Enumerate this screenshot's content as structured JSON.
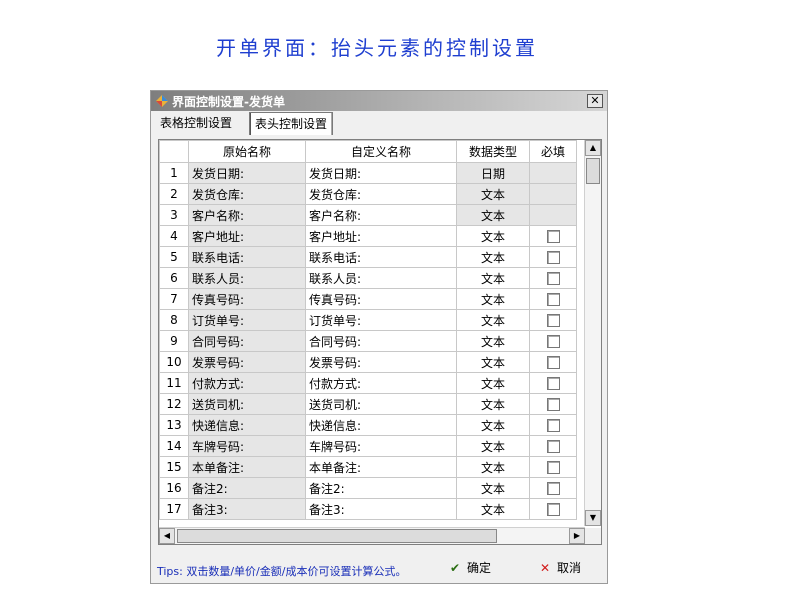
{
  "page_heading": "开单界面：抬头元素的控制设置",
  "window": {
    "title": "界面控制设置-发货单",
    "close_glyph": "✕"
  },
  "tabs": [
    {
      "label": "表格控制设置",
      "active": false
    },
    {
      "label": "表头控制设置",
      "active": true
    }
  ],
  "grid": {
    "headers": [
      "",
      "原始名称",
      "自定义名称",
      "数据类型",
      "必填"
    ],
    "rows": [
      {
        "no": "1",
        "original": "发货日期:",
        "custom": "发货日期:",
        "type": "日期",
        "locked": true
      },
      {
        "no": "2",
        "original": "发货仓库:",
        "custom": "发货仓库:",
        "type": "文本",
        "locked": true
      },
      {
        "no": "3",
        "original": "客户名称:",
        "custom": "客户名称:",
        "type": "文本",
        "locked": true
      },
      {
        "no": "4",
        "original": "客户地址:",
        "custom": "客户地址:",
        "type": "文本",
        "locked": false
      },
      {
        "no": "5",
        "original": "联系电话:",
        "custom": "联系电话:",
        "type": "文本",
        "locked": false
      },
      {
        "no": "6",
        "original": "联系人员:",
        "custom": "联系人员:",
        "type": "文本",
        "locked": false
      },
      {
        "no": "7",
        "original": "传真号码:",
        "custom": "传真号码:",
        "type": "文本",
        "locked": false
      },
      {
        "no": "8",
        "original": "订货单号:",
        "custom": "订货单号:",
        "type": "文本",
        "locked": false
      },
      {
        "no": "9",
        "original": "合同号码:",
        "custom": "合同号码:",
        "type": "文本",
        "locked": false
      },
      {
        "no": "10",
        "original": "发票号码:",
        "custom": "发票号码:",
        "type": "文本",
        "locked": false
      },
      {
        "no": "11",
        "original": "付款方式:",
        "custom": "付款方式:",
        "type": "文本",
        "locked": false
      },
      {
        "no": "12",
        "original": "送货司机:",
        "custom": "送货司机:",
        "type": "文本",
        "locked": false
      },
      {
        "no": "13",
        "original": "快递信息:",
        "custom": "快递信息:",
        "type": "文本",
        "locked": false
      },
      {
        "no": "14",
        "original": "车牌号码:",
        "custom": "车牌号码:",
        "type": "文本",
        "locked": false
      },
      {
        "no": "15",
        "original": "本单备注:",
        "custom": "本单备注:",
        "type": "文本",
        "locked": false
      },
      {
        "no": "16",
        "original": "备注2:",
        "custom": "备注2:",
        "type": "文本",
        "locked": false
      },
      {
        "no": "17",
        "original": "备注3:",
        "custom": "备注3:",
        "type": "文本",
        "locked": false
      }
    ]
  },
  "scroll_glyphs": {
    "up": "▲",
    "down": "▼",
    "left": "◀",
    "right": "▶"
  },
  "footer": {
    "tips": "Tips: 双击数量/单价/金额/成本价可设置计算公式。",
    "ok_label": "确定",
    "ok_icon": "check-icon",
    "ok_glyph": "✔",
    "cancel_label": "取消",
    "cancel_icon": "cross-icon",
    "cancel_glyph": "✕"
  },
  "colors": {
    "heading": "#1f3fd0",
    "tips": "#1a2fb8",
    "ok": "#2a6e12",
    "cancel": "#d21a1a"
  }
}
